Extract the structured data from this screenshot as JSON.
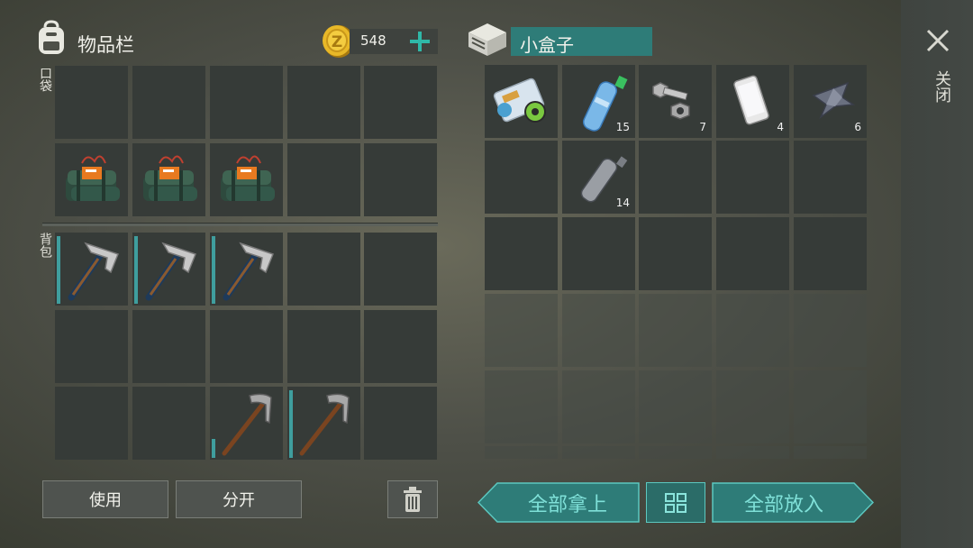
{
  "inventory": {
    "title": "物品栏",
    "coins": "548",
    "pocket_label": "口袋",
    "backpack_label": "背包"
  },
  "container": {
    "title": "小盒子",
    "counts": {
      "water_bottle": "15",
      "bolt_nut": "7",
      "phone": "4",
      "scrap": "6",
      "empty_bottle": "14"
    }
  },
  "actions": {
    "use": "使用",
    "split": "分开",
    "take_all": "全部拿上",
    "put_all": "全部放入",
    "close": "关闭"
  },
  "colors": {
    "accent_teal": "#2e8f8a",
    "coin_gold": "#e0b020",
    "slot_dark": "#363b38"
  }
}
